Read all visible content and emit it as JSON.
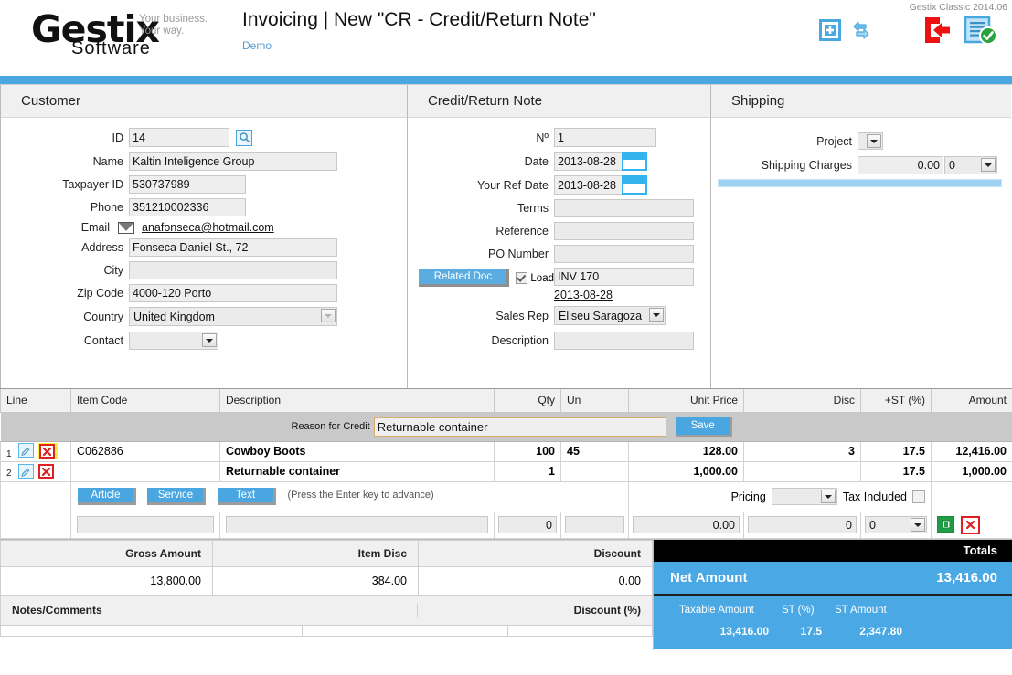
{
  "header": {
    "logo_main": "Gestix",
    "logo_sub": "Software",
    "tagline_line1": "Your business.",
    "tagline_line2": "Your way.",
    "title": "Invoicing | New \"CR - Credit/Return Note\"",
    "demo_label": "Demo",
    "version": "Gestix Classic 2014.06",
    "icons": [
      {
        "name": "add-new-icon"
      },
      {
        "name": "refresh-exchange-icon"
      },
      {
        "name": "exit-back-icon"
      },
      {
        "name": "document-validate-icon"
      }
    ]
  },
  "customer": {
    "title": "Customer",
    "labels": {
      "id": "ID",
      "name": "Name",
      "taxpayer_id": "Taxpayer ID",
      "phone": "Phone",
      "email": "Email",
      "address": "Address",
      "city": "City",
      "zip_code": "Zip Code",
      "country": "Country",
      "contact": "Contact"
    },
    "values": {
      "id": "14",
      "name": "Kaltin Inteligence Group",
      "taxpayer_id": "530737989",
      "phone": "351210002336",
      "email": "anafonseca@hotmail.com",
      "address": "Fonseca Daniel St., 72",
      "city": "",
      "zip_code": "4000-120 Porto",
      "country": "United Kingdom",
      "contact": ""
    }
  },
  "note": {
    "title": "Credit/Return Note",
    "labels": {
      "number": "Nº",
      "date": "Date",
      "your_ref_date": "Your Ref Date",
      "terms": "Terms",
      "reference": "Reference",
      "po_number": "PO Number",
      "load": "Load",
      "sales_rep": "Sales Rep",
      "description": "Description"
    },
    "values": {
      "number": "1",
      "date": "2013-08-28",
      "your_ref_date": "2013-08-28",
      "terms": "",
      "reference": "",
      "po_number": "",
      "related_doc": "INV 170",
      "related_doc_date": "2013-08-28",
      "sales_rep": "Eliseu Saragoza",
      "description": ""
    },
    "related_doc_button": "Related Doc"
  },
  "shipping": {
    "title": "Shipping",
    "labels": {
      "project": "Project",
      "shipping_charges": "Shipping Charges"
    },
    "values": {
      "project": "",
      "shipping_charges": "0.00",
      "shipping_charges_tax": "0"
    }
  },
  "items": {
    "columns": [
      "Line",
      "Item Code",
      "Description",
      "Qty",
      "Un",
      "Unit Price",
      "Disc",
      "+ST (%)",
      "Amount"
    ],
    "reason_label": "Reason for Credit",
    "reason_value": "Returnable container",
    "save_label": "Save",
    "rows": [
      {
        "line": "1",
        "item_code": "C062886",
        "description": "Cowboy Boots",
        "qty": "100",
        "un": "45",
        "unit_price": "128.00",
        "disc": "3",
        "st": "17.5",
        "amount": "12,416.00"
      },
      {
        "line": "2",
        "item_code": "",
        "description": "Returnable container",
        "qty": "1",
        "un": "",
        "unit_price": "1,000.00",
        "disc": "",
        "st": "17.5",
        "amount": "1,000.00"
      }
    ],
    "action_buttons": [
      "Article",
      "Service",
      "Text"
    ],
    "hint": "(Press the Enter key to advance)",
    "pricing_label": "Pricing",
    "pricing_value": "",
    "tax_included_label": "Tax Included",
    "entry": {
      "item_code": "",
      "description": "",
      "qty": "0",
      "un": "",
      "unit_price": "0.00",
      "disc": "0",
      "st": "0"
    }
  },
  "summary": {
    "columns": [
      "Gross Amount",
      "Item Disc",
      "Discount"
    ],
    "values": [
      "13,800.00",
      "384.00",
      "0.00"
    ],
    "notes_label": "Notes/Comments",
    "discount_pct_label": "Discount (%)"
  },
  "totals": {
    "title": "Totals",
    "net_label": "Net Amount",
    "net_value": "13,416.00",
    "st_headers": [
      "Taxable Amount",
      "ST (%)",
      "ST Amount"
    ],
    "st_values": [
      "13,416.00",
      "17.5",
      "2,347.80"
    ]
  },
  "colors": {
    "accent_blue": "#4aa8e0",
    "header_black": "#000000",
    "danger_red": "#e02020",
    "success_green": "#1f9e45",
    "highlight_yellow": "#ffef3f"
  }
}
